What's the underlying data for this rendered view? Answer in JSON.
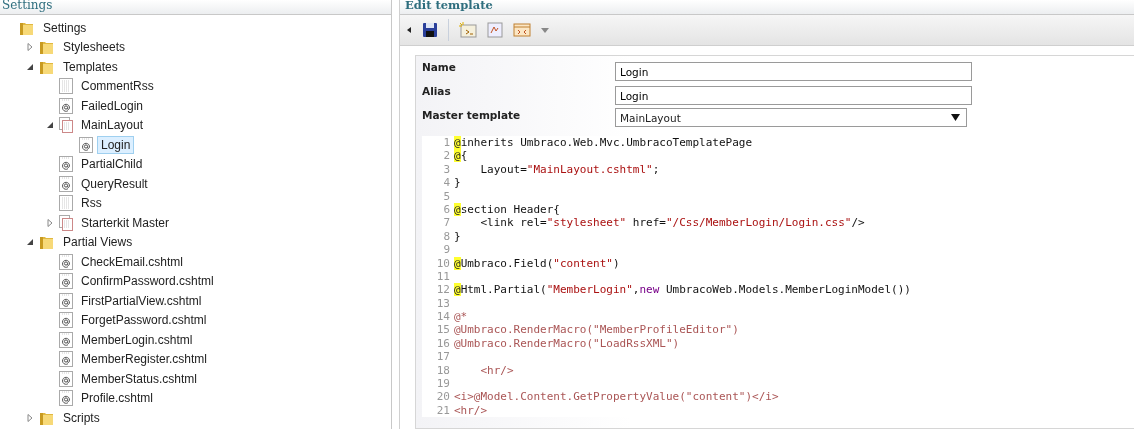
{
  "tree_panel": {
    "title": "Settings",
    "items": [
      {
        "label": "Settings",
        "kind": "folder",
        "selected": false,
        "children": [
          {
            "label": "Stylesheets",
            "kind": "folder",
            "expanded": false,
            "selected": false
          },
          {
            "label": "Templates",
            "kind": "folder",
            "expanded": true,
            "selected": false,
            "children": [
              {
                "label": "CommentRss",
                "kind": "template",
                "selected": false
              },
              {
                "label": "FailedLogin",
                "kind": "razor",
                "selected": false
              },
              {
                "label": "MainLayout",
                "kind": "master",
                "expanded": true,
                "selected": false,
                "children": [
                  {
                    "label": "Login",
                    "kind": "razor",
                    "selected": true
                  }
                ]
              },
              {
                "label": "PartialChild",
                "kind": "razor",
                "selected": false
              },
              {
                "label": "QueryResult",
                "kind": "razor",
                "selected": false
              },
              {
                "label": "Rss",
                "kind": "template",
                "selected": false
              },
              {
                "label": "Starterkit Master",
                "kind": "master",
                "expanded": false,
                "selected": false
              }
            ]
          },
          {
            "label": "Partial Views",
            "kind": "folder",
            "expanded": true,
            "selected": false,
            "children": [
              {
                "label": "CheckEmail.cshtml",
                "kind": "razor",
                "selected": false
              },
              {
                "label": "ConfirmPassword.cshtml",
                "kind": "razor",
                "selected": false
              },
              {
                "label": "FirstPartialView.cshtml",
                "kind": "razor",
                "selected": false
              },
              {
                "label": "ForgetPassword.cshtml",
                "kind": "razor",
                "selected": false
              },
              {
                "label": "MemberLogin.cshtml",
                "kind": "razor",
                "selected": false
              },
              {
                "label": "MemberRegister.cshtml",
                "kind": "razor",
                "selected": false
              },
              {
                "label": "MemberStatus.cshtml",
                "kind": "razor",
                "selected": false
              },
              {
                "label": "Profile.cshtml",
                "kind": "razor",
                "selected": false
              }
            ]
          },
          {
            "label": "Scripts",
            "kind": "folder",
            "expanded": false,
            "selected": false
          }
        ]
      }
    ]
  },
  "editor": {
    "title": "Edit template",
    "toolbar": [
      {
        "kind": "collapse"
      },
      {
        "kind": "save"
      },
      {
        "kind": "separator"
      },
      {
        "kind": "insert-field"
      },
      {
        "kind": "insert-macro"
      },
      {
        "kind": "insert-placeholder"
      },
      {
        "kind": "dropdown"
      }
    ],
    "fields": [
      {
        "label": "Name",
        "kind": "text",
        "value": "Login"
      },
      {
        "label": "Alias",
        "kind": "text",
        "value": "Login"
      },
      {
        "label": "Master template",
        "kind": "select",
        "value": "MainLayout"
      }
    ],
    "code_lines": [
      {
        "number": "1",
        "tokens": [
          {
            "kind": "at",
            "text": "@"
          },
          {
            "kind": "text",
            "text": "inherits Umbraco.Web.Mvc.UmbracoTemplatePage"
          }
        ]
      },
      {
        "number": "2",
        "tokens": [
          {
            "kind": "at",
            "text": "@"
          },
          {
            "kind": "text",
            "text": "{"
          }
        ]
      },
      {
        "number": "3",
        "tokens": [
          {
            "kind": "text",
            "text": "    Layout="
          },
          {
            "kind": "string",
            "text": "\"MainLayout.cshtml\""
          },
          {
            "kind": "text",
            "text": ";"
          }
        ]
      },
      {
        "number": "4",
        "tokens": [
          {
            "kind": "text",
            "text": "}"
          }
        ]
      },
      {
        "number": "5"
      },
      {
        "number": "6",
        "tokens": [
          {
            "kind": "at",
            "text": "@"
          },
          {
            "kind": "text",
            "text": "section Header{"
          }
        ]
      },
      {
        "number": "7",
        "tokens": [
          {
            "kind": "text",
            "text": "    <link rel="
          },
          {
            "kind": "string",
            "text": "\"stylesheet\""
          },
          {
            "kind": "text",
            "text": " href="
          },
          {
            "kind": "string",
            "text": "\"/Css/MemberLogin/Login.css\""
          },
          {
            "kind": "text",
            "text": "/>"
          }
        ]
      },
      {
        "number": "8",
        "tokens": [
          {
            "kind": "text",
            "text": "}"
          }
        ]
      },
      {
        "number": "9"
      },
      {
        "number": "10",
        "tokens": [
          {
            "kind": "at",
            "text": "@"
          },
          {
            "kind": "text",
            "text": "Umbraco.Field("
          },
          {
            "kind": "string",
            "text": "\"content\""
          },
          {
            "kind": "text",
            "text": ")"
          }
        ]
      },
      {
        "number": "11"
      },
      {
        "number": "12",
        "tokens": [
          {
            "kind": "at",
            "text": "@"
          },
          {
            "kind": "text",
            "text": "Html.Partial("
          },
          {
            "kind": "string",
            "text": "\"MemberLogin\""
          },
          {
            "kind": "text",
            "text": ","
          },
          {
            "kind": "keyword",
            "text": "new"
          },
          {
            "kind": "text",
            "text": " UmbracoWeb.Models.MemberLoginModel())"
          }
        ]
      },
      {
        "number": "13"
      },
      {
        "number": "14",
        "tokens": [
          {
            "kind": "comment",
            "text": "@*"
          }
        ]
      },
      {
        "number": "15",
        "tokens": [
          {
            "kind": "comment",
            "text": "@Umbraco.RenderMacro(\"MemberProfileEditor\")"
          }
        ]
      },
      {
        "number": "16",
        "tokens": [
          {
            "kind": "comment",
            "text": "@Umbraco.RenderMacro(\"LoadRssXML\")"
          }
        ]
      },
      {
        "number": "17"
      },
      {
        "number": "18",
        "tokens": [
          {
            "kind": "comment",
            "text": "    <hr/>"
          }
        ]
      },
      {
        "number": "19"
      },
      {
        "number": "20",
        "tokens": [
          {
            "kind": "comment",
            "text": "<i>@Model.Content.GetPropertyValue(\"content\")</i>"
          }
        ]
      },
      {
        "number": "21",
        "tokens": [
          {
            "kind": "comment",
            "text": "<hr/>"
          }
        ]
      }
    ]
  }
}
